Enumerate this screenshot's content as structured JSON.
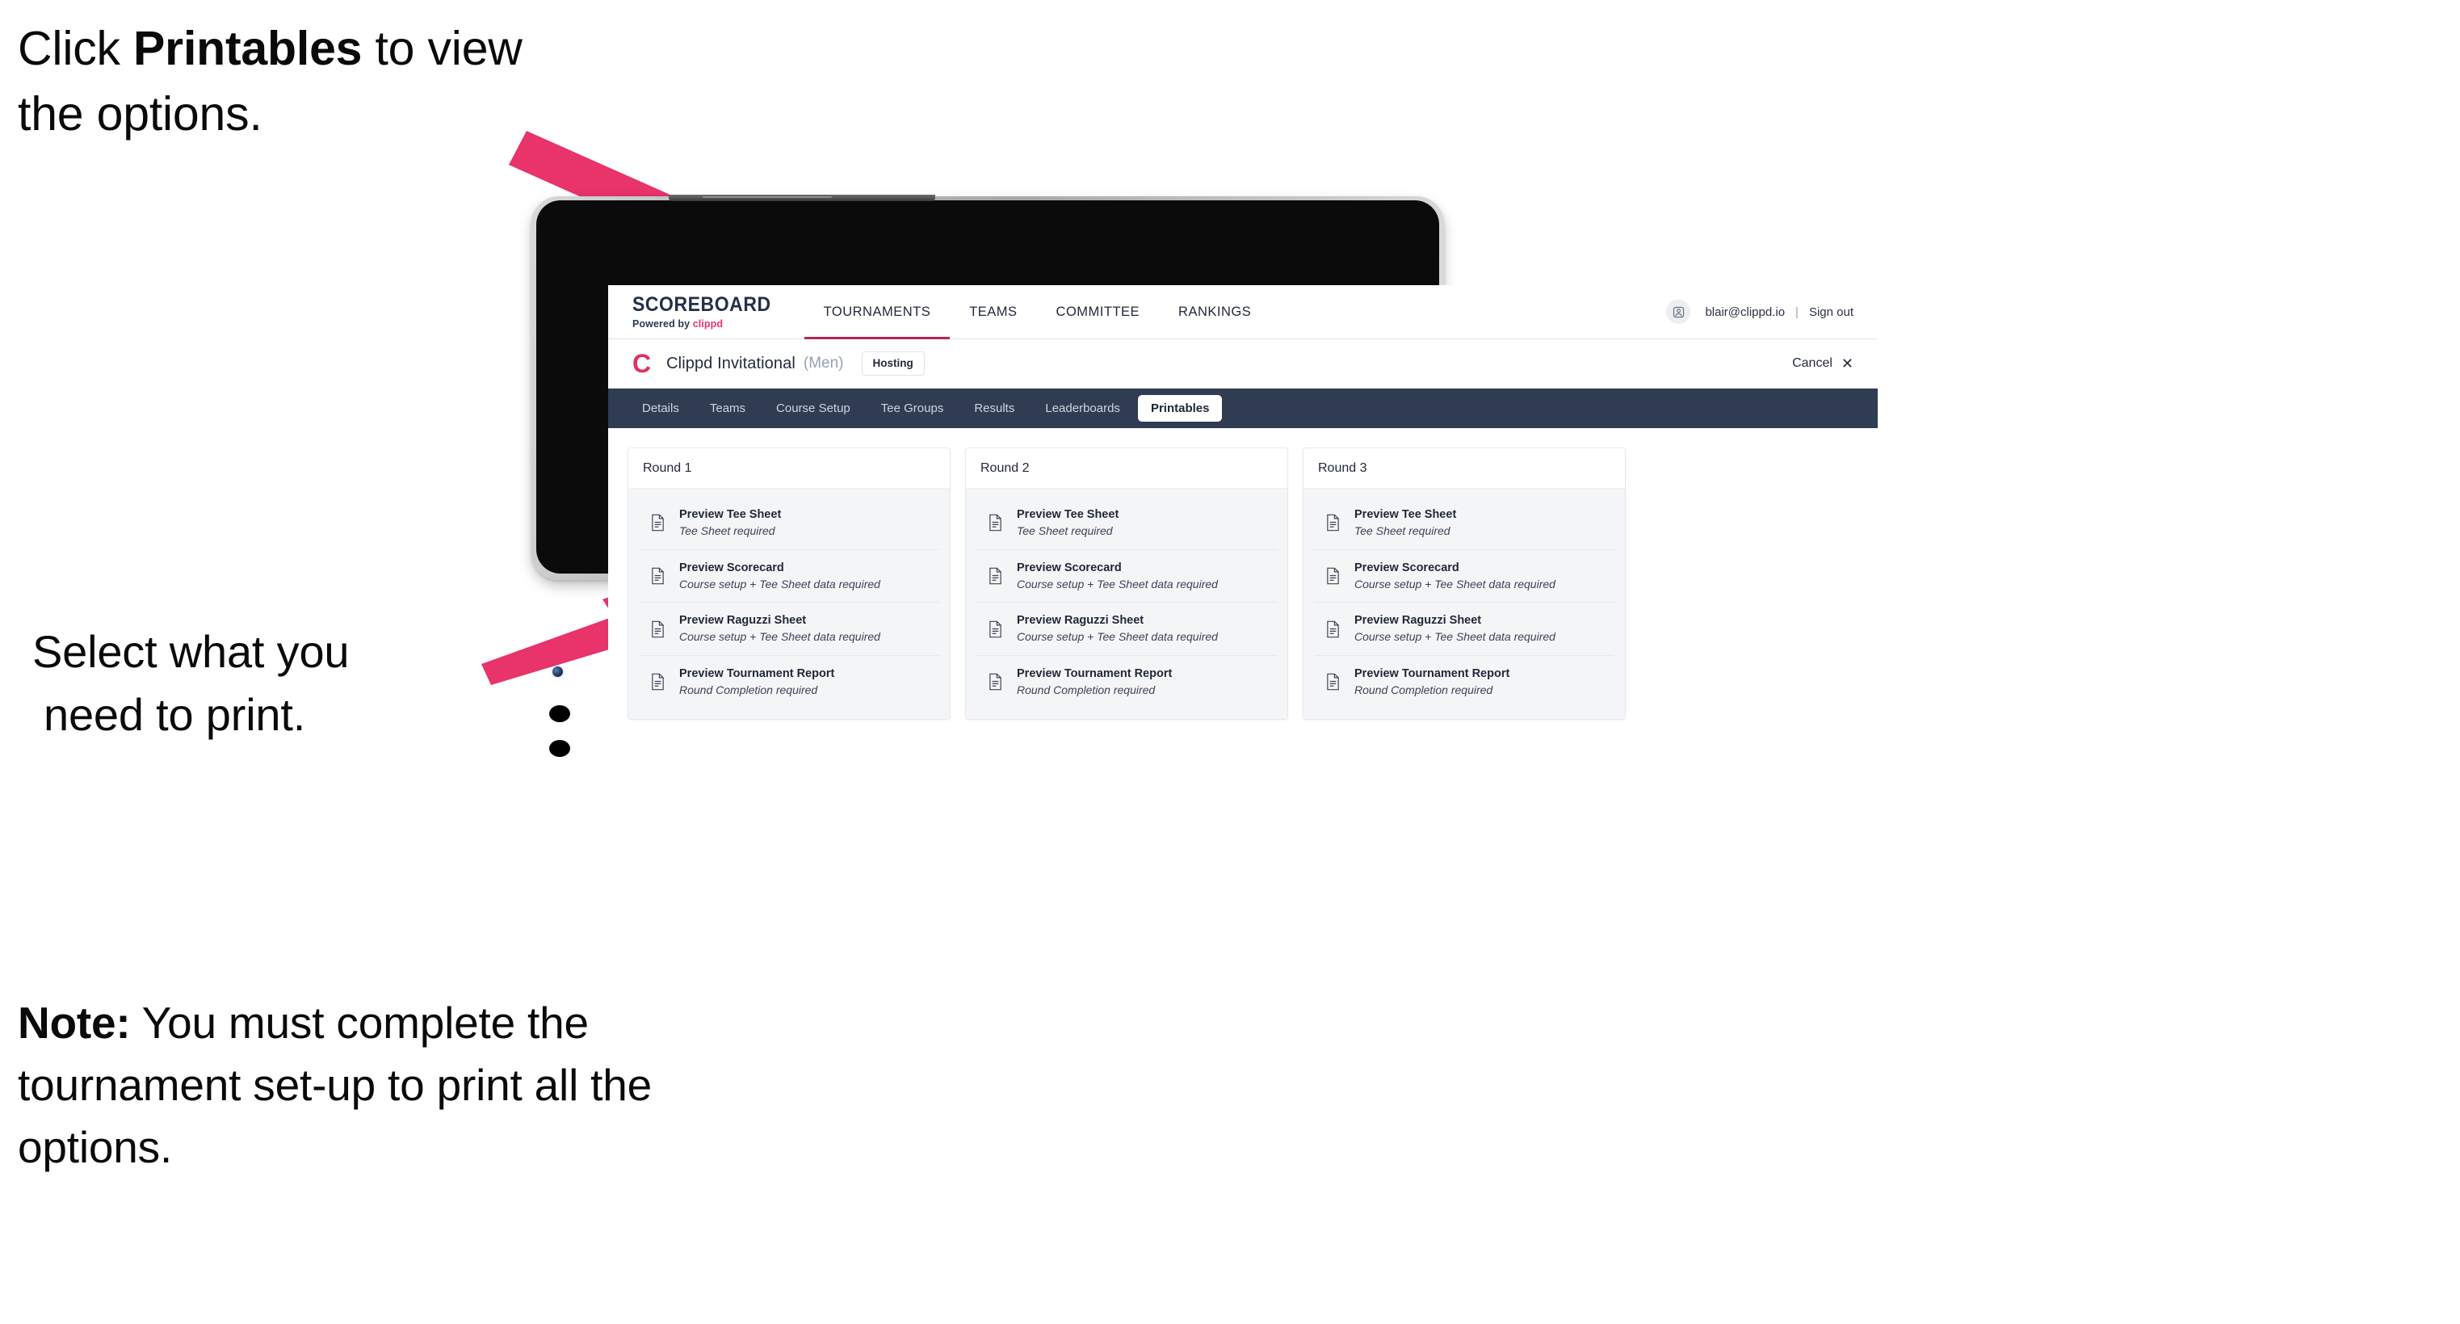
{
  "annotations": {
    "step1": {
      "pre": "Click ",
      "bold": "Printables",
      "post": " to view the options."
    },
    "step2": {
      "line1": "Select what you",
      "line2": "need to print."
    },
    "note": {
      "bold": "Note:",
      "text": " You must complete the tournament set-up to print all the options."
    }
  },
  "app": {
    "brand": {
      "wordmark": "SCOREBOARD",
      "powered_prefix": "Powered by ",
      "powered_brand": "clippd"
    },
    "top_nav": [
      {
        "label": "TOURNAMENTS",
        "active": true
      },
      {
        "label": "TEAMS",
        "active": false
      },
      {
        "label": "COMMITTEE",
        "active": false
      },
      {
        "label": "RANKINGS",
        "active": false
      }
    ],
    "account": {
      "avatar_icon": "user-avatar-icon",
      "email": "blair@clippd.io",
      "separator": "|",
      "sign_out": "Sign out"
    },
    "tournament": {
      "logo_letter": "C",
      "name": "Clippd Invitational",
      "gender": "(Men)",
      "status_badge": "Hosting",
      "cancel_label": "Cancel",
      "cancel_icon": "close-icon"
    },
    "tabs": [
      {
        "label": "Details",
        "active": false
      },
      {
        "label": "Teams",
        "active": false
      },
      {
        "label": "Course Setup",
        "active": false
      },
      {
        "label": "Tee Groups",
        "active": false
      },
      {
        "label": "Results",
        "active": false
      },
      {
        "label": "Leaderboards",
        "active": false
      },
      {
        "label": "Printables",
        "active": true
      }
    ],
    "rounds": [
      {
        "title": "Round 1",
        "items": [
          {
            "icon": "document-icon",
            "title": "Preview Tee Sheet",
            "sub": "Tee Sheet required"
          },
          {
            "icon": "document-icon",
            "title": "Preview Scorecard",
            "sub": "Course setup + Tee Sheet data required"
          },
          {
            "icon": "document-icon",
            "title": "Preview Raguzzi Sheet",
            "sub": "Course setup + Tee Sheet data required"
          },
          {
            "icon": "document-icon",
            "title": "Preview Tournament Report",
            "sub": "Round Completion required"
          }
        ]
      },
      {
        "title": "Round 2",
        "items": [
          {
            "icon": "document-icon",
            "title": "Preview Tee Sheet",
            "sub": "Tee Sheet required"
          },
          {
            "icon": "document-icon",
            "title": "Preview Scorecard",
            "sub": "Course setup + Tee Sheet data required"
          },
          {
            "icon": "document-icon",
            "title": "Preview Raguzzi Sheet",
            "sub": "Course setup + Tee Sheet data required"
          },
          {
            "icon": "document-icon",
            "title": "Preview Tournament Report",
            "sub": "Round Completion required"
          }
        ]
      },
      {
        "title": "Round 3",
        "items": [
          {
            "icon": "document-icon",
            "title": "Preview Tee Sheet",
            "sub": "Tee Sheet required"
          },
          {
            "icon": "document-icon",
            "title": "Preview Scorecard",
            "sub": "Course setup + Tee Sheet data required"
          },
          {
            "icon": "document-icon",
            "title": "Preview Raguzzi Sheet",
            "sub": "Course setup + Tee Sheet data required"
          },
          {
            "icon": "document-icon",
            "title": "Preview Tournament Report",
            "sub": "Round Completion required"
          }
        ]
      }
    ]
  },
  "colors": {
    "accent_pink": "#e8336b",
    "arrow": "#e8336b",
    "tabstrip_dark": "#2f3c52",
    "brand_navy": "#22304a",
    "active_underline": "#b4255a"
  }
}
